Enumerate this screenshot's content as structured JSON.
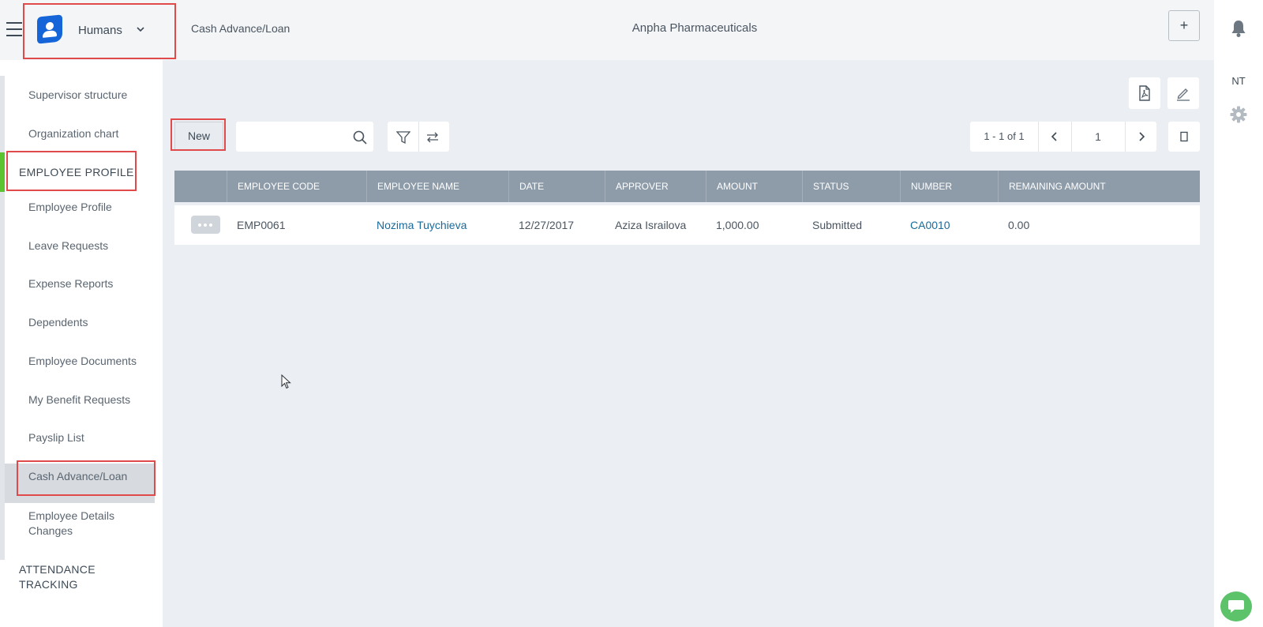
{
  "header": {
    "app_name": "Humans",
    "breadcrumb": "Cash Advance/Loan",
    "company": "Anpha Pharmaceuticals",
    "add_label": "+"
  },
  "user": {
    "initials": "NT"
  },
  "sidebar": {
    "top_items": [
      "Supervisor structure",
      "Organization chart"
    ],
    "section_employee_profile": "EMPLOYEE PROFILE",
    "items": [
      "Employee Profile",
      "Leave Requests",
      "Expense Reports",
      "Dependents",
      "Employee Documents",
      "My Benefit Requests",
      "Payslip List",
      "Cash Advance/Loan",
      "Employee Details Changes"
    ],
    "selected": "Cash Advance/Loan",
    "section_attendance": "ATTENDANCE TRACKING"
  },
  "toolbar": {
    "new_label": "New",
    "search_placeholder": "",
    "pager_range": "1 - 1 of 1",
    "page_number": "1"
  },
  "table": {
    "columns": [
      "EMPLOYEE CODE",
      "EMPLOYEE NAME",
      "DATE",
      "APPROVER",
      "AMOUNT",
      "STATUS",
      "NUMBER",
      "REMAINING AMOUNT"
    ],
    "rows": [
      {
        "employee_code": "EMP0061",
        "employee_name": "Nozima Tuychieva",
        "date": "12/27/2017",
        "approver": "Aziza Israilova",
        "amount": "1,000.00",
        "status": "Submitted",
        "number": "CA0010",
        "remaining_amount": "0.00"
      }
    ]
  },
  "colors": {
    "brand_blue": "#1565d8",
    "active_green": "#5cc330",
    "highlight_red": "#e04a4a",
    "grid_header": "#8e9caa",
    "link": "#1a6a9a",
    "chat_green": "#5cc36b"
  },
  "icons": [
    "hamburger-icon",
    "user-app-icon",
    "chevron-down-icon",
    "plus-icon",
    "bell-icon",
    "gear-icon",
    "chat-icon",
    "pdf-icon",
    "pencil-icon",
    "search-icon",
    "filter-icon",
    "swap-icon",
    "chevron-left-icon",
    "chevron-right-icon",
    "view-toggle-icon",
    "more-dots-icon"
  ]
}
